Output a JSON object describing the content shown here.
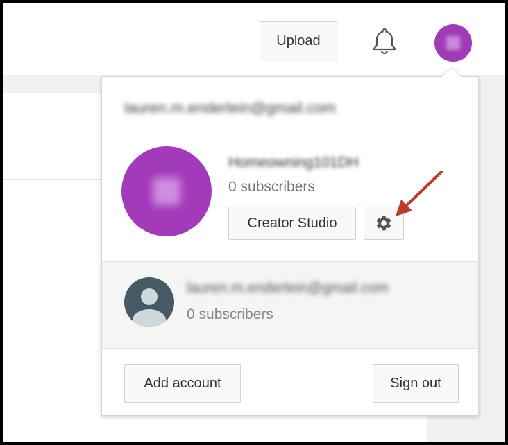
{
  "header": {
    "upload_label": "Upload",
    "bell_icon": "bell-icon",
    "avatar_icon": "account-avatar"
  },
  "account_menu": {
    "email": "lauren.m.enderlein@gmail.com",
    "channel_name": "Homeowning101DH",
    "subscribers": "0 subscribers",
    "creator_studio_label": "Creator Studio",
    "settings_icon": "gear-icon",
    "other_account": {
      "email": "lauren.m.enderlein@gmail.com",
      "subscribers": "0 subscribers"
    },
    "add_account_label": "Add account",
    "sign_out_label": "Sign out"
  },
  "annotation": {
    "arrow_color": "#c0392b"
  },
  "colors": {
    "avatar_purple": "#a23ab9",
    "default_avatar": "#455a64"
  }
}
